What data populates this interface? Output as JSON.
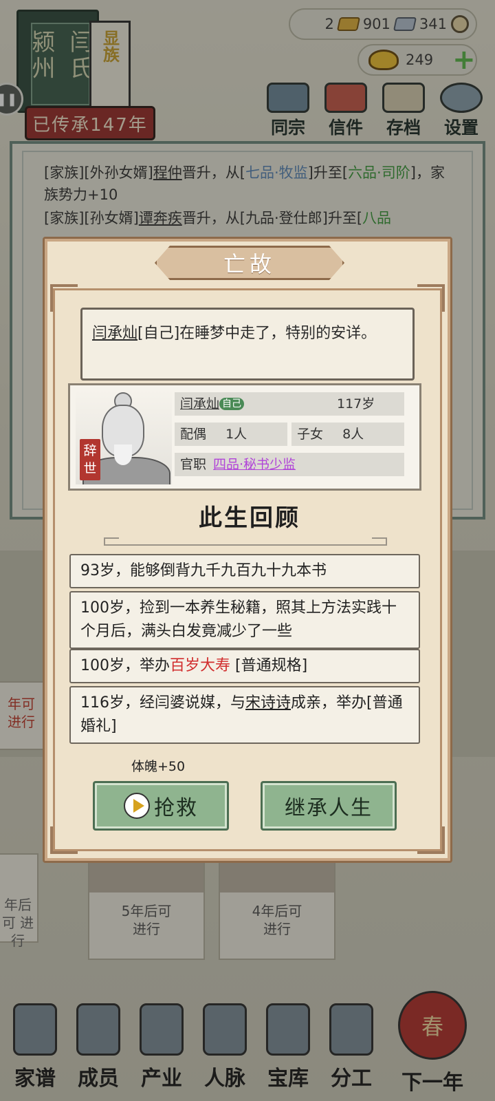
{
  "banner": {
    "clan_name": "颍州",
    "family_name": "闫氏",
    "status_tag": "显族",
    "lineage": "已传承147年",
    "chat_icon": "chat-icon"
  },
  "resources": {
    "gold": "2",
    "silver": "901",
    "coins": "341",
    "ingot": "249",
    "add_icon": "plus-icon"
  },
  "top_menu": [
    {
      "label": "同宗",
      "icon": "clan-icon"
    },
    {
      "label": "信件",
      "icon": "letter-icon"
    },
    {
      "label": "存档",
      "icon": "save-icon"
    },
    {
      "label": "设置",
      "icon": "settings-icon"
    }
  ],
  "log": {
    "line1": {
      "p1": "[家族][外孙女婿]",
      "name": "程仲",
      "p2": "晋升，从[",
      "from": "七品·牧监",
      "p3": "]升至[",
      "to": "六品·司阶",
      "p4": "]，家族势力+10"
    },
    "line2": {
      "p1": "[家族][孙女婿]",
      "name": "谭奔疾",
      "p2": "晋升，从[九品·登仕郎]升至[",
      "to": "八品"
    }
  },
  "side_cards": {
    "left_mid": "年可\n进行",
    "left_bottom": "年后可\n进行",
    "card_a": "5年后可\n进行",
    "card_b": "4年后可\n进行"
  },
  "nav": [
    {
      "label": "家谱",
      "icon": "genealogy-icon"
    },
    {
      "label": "成员",
      "icon": "members-icon"
    },
    {
      "label": "产业",
      "icon": "property-icon"
    },
    {
      "label": "人脉",
      "icon": "network-icon"
    },
    {
      "label": "宝库",
      "icon": "treasury-icon"
    },
    {
      "label": "分工",
      "icon": "tasks-icon"
    },
    {
      "label": "下一年",
      "icon": "lantern-icon",
      "badge": "春"
    }
  ],
  "dialog": {
    "title": "亡故",
    "message": {
      "name": "闫承灿",
      "text": "[自己]在睡梦中走了，特别的安详。"
    },
    "person": {
      "name": "闫承灿",
      "self_badge": "自己",
      "age": "117岁",
      "spouse_label": "配偶",
      "spouse_value": "1人",
      "children_label": "子女",
      "children_value": "8人",
      "office_label": "官职",
      "office_value": "四品·秘书少监",
      "stamp": "辞世"
    },
    "review_title": "此生回顾",
    "events": [
      {
        "text": "93岁，能够倒背九千九百九十九本书"
      },
      {
        "text": "100岁，捡到一本养生秘籍，照其上方法实践十个月后，满头白发竟减少了一些"
      },
      {
        "p1": "100岁，举办",
        "highlight": "百岁大寿",
        "p2": " [普通规格]"
      },
      {
        "p1": "116岁，经闫婆说媒，与",
        "name": "宋诗诗",
        "p2": "成亲，举办[普通婚礼]"
      }
    ],
    "bonus": "体魄+50",
    "rescue_label": "抢救",
    "inherit_label": "继承人生"
  },
  "colors": {
    "dialog_bg": "#eee2cb",
    "button_green": "#8fb48f",
    "highlight_red": "#d12d2d",
    "rank_purple": "#b145d8"
  }
}
